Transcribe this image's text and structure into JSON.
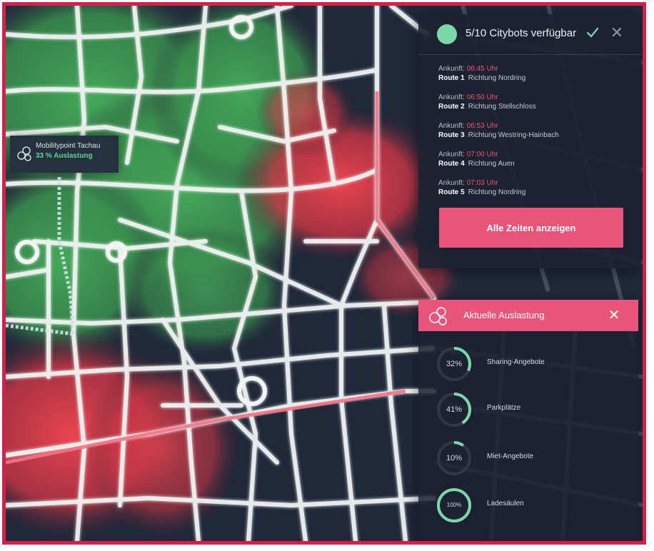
{
  "mobility_point": {
    "name": "Mobilitypoint Tachau",
    "load": "33 % Auslastung",
    "icon": "bike-share-icon"
  },
  "citybots": {
    "title": "5/10 Citybots verfügbar",
    "status_icon": "checkmark-icon",
    "close_icon": "close-icon",
    "routes": [
      {
        "arrival_label": "Ankunft:",
        "time": "06:45 Uhr",
        "route": "Route 1",
        "direction": "Richtung Nordring"
      },
      {
        "arrival_label": "Ankunft:",
        "time": "06:50 Uhr",
        "route": "Route 2",
        "direction": "Richtung Stellschloss"
      },
      {
        "arrival_label": "Ankunft:",
        "time": "06:53 Uhr",
        "route": "Route 3",
        "direction": "Richtung Westring-Hainbach"
      },
      {
        "arrival_label": "Ankunft:",
        "time": "07:00 Uhr",
        "route": "Route 4",
        "direction": "Richtung Auen"
      },
      {
        "arrival_label": "Ankunft:",
        "time": "07:03 Uhr",
        "route": "Route 5",
        "direction": "Richtung Nordring"
      }
    ],
    "button_label": "Alle Zeiten anzeigen"
  },
  "auslastung": {
    "title": "Aktuelle Auslastung",
    "icon": "bike-share-icon",
    "close_icon": "close-icon",
    "items": [
      {
        "label": "Sharing-Angebote",
        "percent_text": "32%",
        "value": 0.32
      },
      {
        "label": "Parkplätze",
        "percent_text": "41%",
        "value": 0.41
      },
      {
        "label": "Miet-Angebote",
        "percent_text": "10%",
        "value": 0.1
      },
      {
        "label": "Ladesäulen",
        "percent_text": "100%",
        "value": 1.0
      }
    ]
  },
  "colors": {
    "frame": "#d21f4b",
    "accent": "#e9557a",
    "gauge": "#7dd8a9",
    "heat_green": "#3f9f55",
    "heat_red": "#e9444f",
    "panel_bg": "#1d2231"
  }
}
